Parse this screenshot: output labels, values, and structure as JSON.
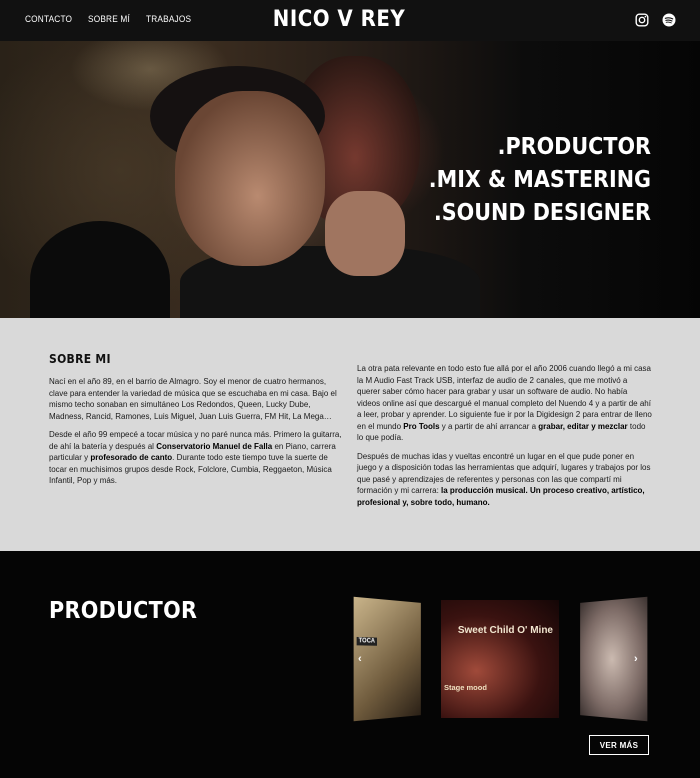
{
  "header": {
    "nav": [
      {
        "label": "CONTACTO"
      },
      {
        "label": "SOBRE MÍ"
      },
      {
        "label": "TRABAJOS"
      }
    ],
    "logo": "NICO V REY",
    "social_icons": [
      "instagram-icon",
      "spotify-icon"
    ]
  },
  "hero": {
    "titles": [
      ".PRODUCTOR",
      ".MIX & MASTERING",
      ".SOUND DESIGNER"
    ]
  },
  "about": {
    "heading": "SOBRE MI",
    "left": [
      "Nací en el año 89, en el barrio de Almagro. Soy el menor de cuatro hermanos, clave para entender la variedad de música que se escuchaba en mi casa. Bajo el mismo techo sonaban en simultáneo Los Redondos, Queen, Lucky Dube, Madness, Rancid, Ramones, Luis Miguel, Juan Luis Guerra, FM Hit, La Mega…",
      {
        "a": "Desde el año 99 empecé a tocar música y no paré nunca más. Primero la guitarra, de ahí la batería y después al ",
        "b": "Conservatorio Manuel de Falla",
        "c": " en Piano, carrera particular y ",
        "d": "profesorado de canto",
        "e": ". Durante todo este tiempo tuve la suerte de tocar en muchisimos grupos desde Rock, Folclore, Cumbia, Reggaeton, Música Infantil, Pop y más."
      }
    ],
    "right": [
      {
        "a": "La otra pata relevante en todo esto fue allá por el año 2006 cuando llegó a mi casa la M Audio Fast Track USB, interfaz de audio de 2 canales, que me motivó a querer saber cómo hacer para grabar y usar un software de audio. No había videos online así que descargué el manual completo del Nuendo 4 y a partir de ahí a leer, probar y aprender. Lo siguiente fue ir por la Digidesign 2 para entrar de lleno en el mundo ",
        "b": "Pro Tools",
        "c": " y a partir de ahí arrancar a ",
        "d": "grabar, editar y mezclar",
        "e": " todo lo que podía."
      },
      {
        "a": "Después de muchas idas y vueltas encontré un lugar en el que pude poner en juego y a disposición todas las herramientas que adquirí, lugares y trabajos por los que pasé y aprendizajes de referentes y personas con las que compartí mi formación y mi carrera: ",
        "b": "la producción musical. Un proceso creativo, artístico, profesional y, sobre todo, humano."
      }
    ]
  },
  "productor": {
    "heading": "PRODUCTOR",
    "cards": [
      {
        "name": "album-cover-left",
        "text": "TOCA"
      },
      {
        "name": "album-cover-center",
        "title": "Sweet Child O' Mine",
        "tag": "Stage mood"
      },
      {
        "name": "album-cover-right"
      }
    ],
    "button": "VER MÁS"
  }
}
